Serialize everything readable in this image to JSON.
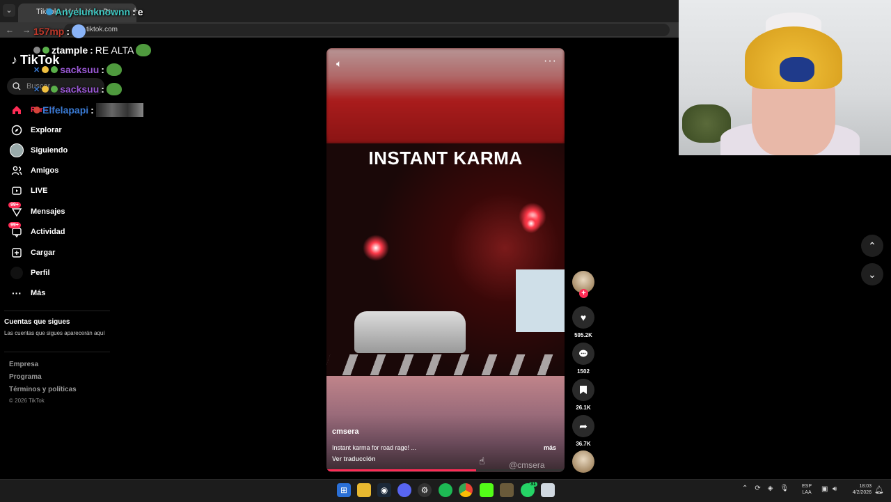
{
  "browser": {
    "tab_title": "TikTok - Make Your Day",
    "url": "tiktok.com"
  },
  "sidebar": {
    "logo": "TikTok",
    "search_placeholder": "Buscar",
    "items": [
      {
        "label": "Para ti",
        "icon": "home-icon"
      },
      {
        "label": "Explorar",
        "icon": "compass-icon"
      },
      {
        "label": "Siguiendo",
        "icon": "following-avatar-icon"
      },
      {
        "label": "Amigos",
        "icon": "friends-icon"
      },
      {
        "label": "LIVE",
        "icon": "live-icon"
      },
      {
        "label": "Mensajes",
        "icon": "messages-icon",
        "badge": "99+"
      },
      {
        "label": "Actividad",
        "icon": "activity-icon",
        "badge": "99+"
      },
      {
        "label": "Cargar",
        "icon": "upload-icon"
      },
      {
        "label": "Perfil",
        "icon": "profile-icon"
      },
      {
        "label": "Más",
        "icon": "more-icon"
      }
    ],
    "following_heading": "Cuentas que sigues",
    "following_note": "Las cuentas que sigues aparecerán aquí",
    "footer": [
      "Empresa",
      "Programa",
      "Términos y políticas"
    ],
    "copyright": "© 2026 TikTok"
  },
  "chat": [
    {
      "user": "Anyelunknownn",
      "message": "e",
      "color": "#3ec6c0"
    },
    {
      "user": "157mp",
      "message": "",
      "color": "#c0392b"
    },
    {
      "user": "ztample",
      "message": "RE ALTA",
      "color": "#ffffff"
    },
    {
      "user": "sacksuu",
      "message": "",
      "color": "#9b59d6"
    },
    {
      "user": "sacksuu",
      "message": "",
      "color": "#9b59d6"
    },
    {
      "user": "Elfelapapi",
      "message": "",
      "color": "#3a7bd5"
    }
  ],
  "video": {
    "overlay_title": "INSTANT KARMA",
    "author": "cmsera",
    "description": "Instant karma for road rage! ...",
    "more_label": "más",
    "translate_label": "Ver traducción",
    "watermark": "@cmsera",
    "progress": 0.63
  },
  "actions": {
    "likes": "595.2K",
    "comments": "1502",
    "saves": "26.1K",
    "shares": "36.7K"
  },
  "taskbar": {
    "lang_top": "ESP",
    "lang_bottom": "LAA",
    "time": "18:03",
    "date": "4/2/2026",
    "whatsapp_badge": "31"
  }
}
